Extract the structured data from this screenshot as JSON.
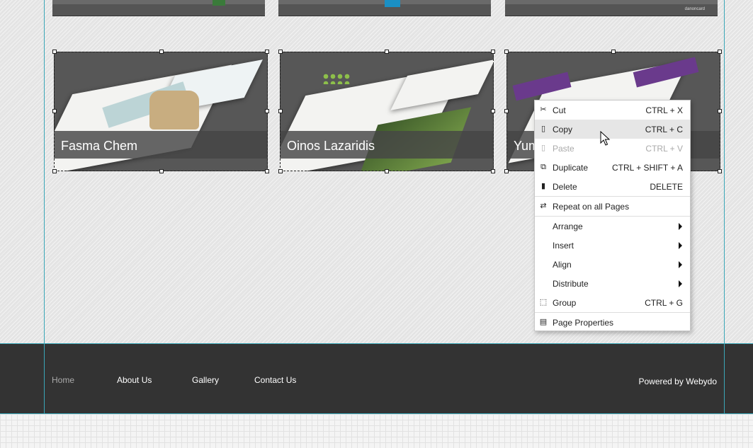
{
  "gallery": {
    "cards": [
      {
        "caption": "Fasma Chem"
      },
      {
        "caption": "Oinos Lazaridis"
      },
      {
        "caption": "Yum"
      }
    ],
    "top_thumb_text": "danoncard"
  },
  "context_menu": {
    "items": [
      {
        "label": "Cut",
        "shortcut": "CTRL + X",
        "icon": "scissors-icon"
      },
      {
        "label": "Copy",
        "shortcut": "CTRL + C",
        "icon": "clipboard-icon"
      },
      {
        "label": "Paste",
        "shortcut": "CTRL + V",
        "icon": "paste-icon",
        "disabled": true
      },
      {
        "label": "Duplicate",
        "shortcut": "CTRL + SHIFT + A",
        "icon": "duplicate-icon"
      },
      {
        "label": "Delete",
        "shortcut": "DELETE",
        "icon": "trash-icon"
      },
      {
        "label": "Repeat on all Pages",
        "icon": "repeat-icon"
      },
      {
        "label": "Arrange",
        "submenu": true
      },
      {
        "label": "Insert",
        "submenu": true
      },
      {
        "label": "Align",
        "submenu": true
      },
      {
        "label": "Distribute",
        "submenu": true
      },
      {
        "label": "Group",
        "shortcut": "CTRL + G",
        "icon": "group-icon"
      },
      {
        "label": "Page Properties",
        "icon": "page-icon"
      }
    ],
    "hovered": "Copy"
  },
  "footer": {
    "nav": [
      "Home",
      "About Us",
      "Gallery",
      "Contact Us"
    ],
    "powered_by": "Powered by Webydo"
  },
  "colors": {
    "guide": "#3aa7b8",
    "footer_bg": "#333333",
    "card_bg": "#575757"
  }
}
